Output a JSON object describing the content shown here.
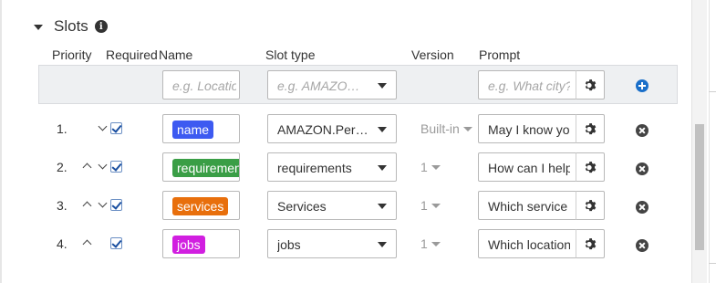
{
  "section": {
    "title": "Slots",
    "info_icon": "info-icon"
  },
  "columns": {
    "priority": "Priority",
    "required": "Required",
    "name": "Name",
    "slot_type": "Slot type",
    "version": "Version",
    "prompt": "Prompt"
  },
  "add_row": {
    "name_placeholder": "e.g. Location",
    "slot_type_placeholder": "e.g. AMAZON.US_CITY",
    "prompt_placeholder": "e.g. What city?"
  },
  "colors": {
    "pill_name": "#3d5af1",
    "pill_requirements": "#3a9e46",
    "pill_services": "#e86f0c",
    "pill_jobs": "#d11fe0",
    "add_button": "#1a6fc9"
  },
  "rows": [
    {
      "priority": "1.",
      "slot_name": "name",
      "slot_type": "AMAZON.Person",
      "version": "Built-in",
      "prompt": "May I know your name?"
    },
    {
      "priority": "2.",
      "slot_name": "requirements",
      "slot_type": "requirements",
      "version": "1",
      "prompt": "How can I help you?"
    },
    {
      "priority": "3.",
      "slot_name": "services",
      "slot_type": "Services",
      "version": "1",
      "prompt": "Which service do you need?"
    },
    {
      "priority": "4.",
      "slot_name": "jobs",
      "slot_type": "jobs",
      "version": "1",
      "prompt": "Which location?"
    }
  ]
}
